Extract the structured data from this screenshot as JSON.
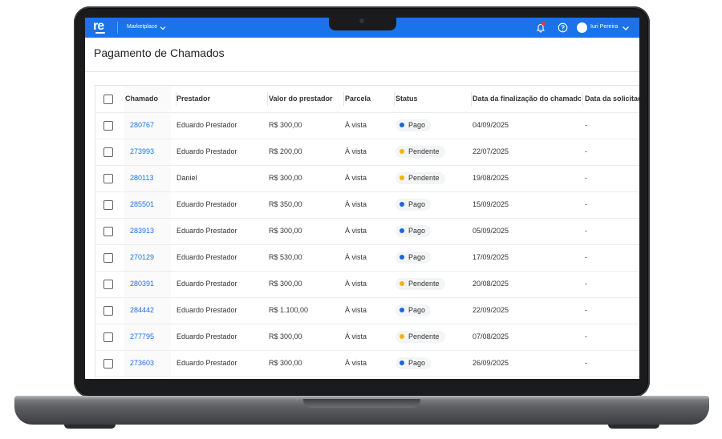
{
  "header": {
    "logo": "re",
    "app_switcher": "Marketplace",
    "user_name": "Iuri Pereira",
    "colors": {
      "topbar": "#1a73e8",
      "badge": "#e53935"
    }
  },
  "page": {
    "title": "Pagamento de Chamados"
  },
  "table": {
    "columns": [
      "Chamado",
      "Prestador",
      "Valor do prestador",
      "Parcela",
      "Status",
      "Data da finalização do chamado",
      "Data da solicitação"
    ],
    "rows": [
      {
        "chamado": "280767",
        "prestador": "Eduardo Prestador",
        "valor": "R$ 300,00",
        "parcela": "À vista",
        "status": "Pago",
        "data_finalizacao": "04/09/2025",
        "data_solicitacao": "-"
      },
      {
        "chamado": "273993",
        "prestador": "Eduardo Prestador",
        "valor": "R$ 200,00",
        "parcela": "À vista",
        "status": "Pendente",
        "data_finalizacao": "22/07/2025",
        "data_solicitacao": "-"
      },
      {
        "chamado": "280113",
        "prestador": "Daniel",
        "valor": "R$ 300,00",
        "parcela": "À vista",
        "status": "Pendente",
        "data_finalizacao": "19/08/2025",
        "data_solicitacao": "-"
      },
      {
        "chamado": "285501",
        "prestador": "Eduardo Prestador",
        "valor": "R$ 350,00",
        "parcela": "À vista",
        "status": "Pago",
        "data_finalizacao": "15/09/2025",
        "data_solicitacao": "-"
      },
      {
        "chamado": "283913",
        "prestador": "Eduardo Prestador",
        "valor": "R$ 300,00",
        "parcela": "À vista",
        "status": "Pago",
        "data_finalizacao": "05/09/2025",
        "data_solicitacao": "-"
      },
      {
        "chamado": "270129",
        "prestador": "Eduardo Prestador",
        "valor": "R$ 530,00",
        "parcela": "À vista",
        "status": "Pago",
        "data_finalizacao": "17/09/2025",
        "data_solicitacao": "-"
      },
      {
        "chamado": "280391",
        "prestador": "Eduardo Prestador",
        "valor": "R$ 300,00",
        "parcela": "À vista",
        "status": "Pendente",
        "data_finalizacao": "20/08/2025",
        "data_solicitacao": "-"
      },
      {
        "chamado": "284442",
        "prestador": "Eduardo Prestador",
        "valor": "R$ 1.100,00",
        "parcela": "À vista",
        "status": "Pago",
        "data_finalizacao": "22/09/2025",
        "data_solicitacao": "-"
      },
      {
        "chamado": "277795",
        "prestador": "Eduardo Prestador",
        "valor": "R$ 300,00",
        "parcela": "À vista",
        "status": "Pendente",
        "data_finalizacao": "07/08/2025",
        "data_solicitacao": "-"
      },
      {
        "chamado": "273603",
        "prestador": "Eduardo Prestador",
        "valor": "R$ 300,00",
        "parcela": "À vista",
        "status": "Pago",
        "data_finalizacao": "26/09/2025",
        "data_solicitacao": "-"
      }
    ]
  },
  "status_colors": {
    "Pago": "#1a66d9",
    "Pendente": "#f5b400"
  },
  "icons": [
    "chevron-down-icon",
    "bell-icon",
    "help-icon",
    "avatar"
  ]
}
